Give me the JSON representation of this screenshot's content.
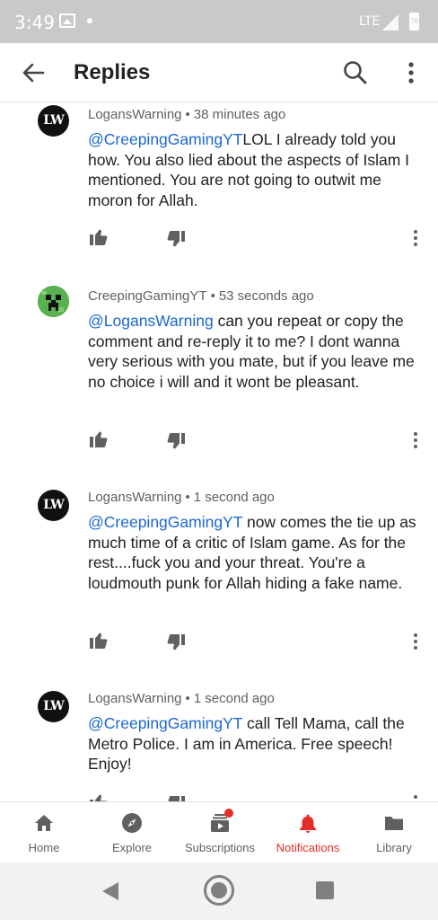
{
  "status_bar": {
    "time": "3:49",
    "network": "LTE",
    "battery": "76"
  },
  "app_bar": {
    "title": "Replies"
  },
  "comments": [
    {
      "avatar": "LW",
      "author": "LogansWarning",
      "separator": "•",
      "time": "38 minutes ago",
      "mention": "@CreepingGamingYT",
      "text": "LOL I already told you how. You also lied about the aspects of Islam I mentioned. You are not going to outwit me moron for Allah."
    },
    {
      "avatar": "creeper",
      "author": "CreepingGamingYT",
      "separator": "•",
      "time": "53 seconds ago",
      "mention": "@LogansWarning",
      "text": " can you repeat or copy the comment and re-reply it to me? I dont wanna very serious with you mate, but if you leave me no choice i will and it wont be pleasant."
    },
    {
      "avatar": "LW",
      "author": "LogansWarning",
      "separator": "•",
      "time": "1 second ago",
      "mention": "@CreepingGamingYT",
      "text": " now comes the tie up as much time of a critic of Islam game. As for the rest....fuck you and your threat. You're a loudmouth punk for Allah hiding a fake name."
    },
    {
      "avatar": "LW",
      "author": "LogansWarning",
      "separator": "•",
      "time": "1 second ago",
      "mention": "@CreepingGamingYT",
      "text": " call Tell Mama, call the Metro Police. I am in America. Free speech! Enjoy!"
    }
  ],
  "bottom_nav": [
    {
      "label": "Home",
      "icon": "home-icon"
    },
    {
      "label": "Explore",
      "icon": "compass-icon"
    },
    {
      "label": "Subscriptions",
      "icon": "subscriptions-icon"
    },
    {
      "label": "Notifications",
      "icon": "bell-icon"
    },
    {
      "label": "Library",
      "icon": "folder-icon"
    }
  ],
  "colors": {
    "accent": "#e52d27",
    "mention": "#1a67d2",
    "meta": "#606060"
  }
}
